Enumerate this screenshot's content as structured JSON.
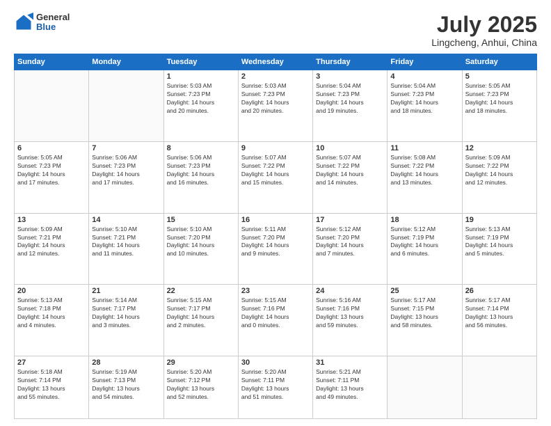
{
  "header": {
    "logo_general": "General",
    "logo_blue": "Blue",
    "month_title": "July 2025",
    "location": "Lingcheng, Anhui, China"
  },
  "weekdays": [
    "Sunday",
    "Monday",
    "Tuesday",
    "Wednesday",
    "Thursday",
    "Friday",
    "Saturday"
  ],
  "weeks": [
    [
      {
        "day": "",
        "info": ""
      },
      {
        "day": "",
        "info": ""
      },
      {
        "day": "1",
        "info": "Sunrise: 5:03 AM\nSunset: 7:23 PM\nDaylight: 14 hours\nand 20 minutes."
      },
      {
        "day": "2",
        "info": "Sunrise: 5:03 AM\nSunset: 7:23 PM\nDaylight: 14 hours\nand 20 minutes."
      },
      {
        "day": "3",
        "info": "Sunrise: 5:04 AM\nSunset: 7:23 PM\nDaylight: 14 hours\nand 19 minutes."
      },
      {
        "day": "4",
        "info": "Sunrise: 5:04 AM\nSunset: 7:23 PM\nDaylight: 14 hours\nand 18 minutes."
      },
      {
        "day": "5",
        "info": "Sunrise: 5:05 AM\nSunset: 7:23 PM\nDaylight: 14 hours\nand 18 minutes."
      }
    ],
    [
      {
        "day": "6",
        "info": "Sunrise: 5:05 AM\nSunset: 7:23 PM\nDaylight: 14 hours\nand 17 minutes."
      },
      {
        "day": "7",
        "info": "Sunrise: 5:06 AM\nSunset: 7:23 PM\nDaylight: 14 hours\nand 17 minutes."
      },
      {
        "day": "8",
        "info": "Sunrise: 5:06 AM\nSunset: 7:23 PM\nDaylight: 14 hours\nand 16 minutes."
      },
      {
        "day": "9",
        "info": "Sunrise: 5:07 AM\nSunset: 7:22 PM\nDaylight: 14 hours\nand 15 minutes."
      },
      {
        "day": "10",
        "info": "Sunrise: 5:07 AM\nSunset: 7:22 PM\nDaylight: 14 hours\nand 14 minutes."
      },
      {
        "day": "11",
        "info": "Sunrise: 5:08 AM\nSunset: 7:22 PM\nDaylight: 14 hours\nand 13 minutes."
      },
      {
        "day": "12",
        "info": "Sunrise: 5:09 AM\nSunset: 7:22 PM\nDaylight: 14 hours\nand 12 minutes."
      }
    ],
    [
      {
        "day": "13",
        "info": "Sunrise: 5:09 AM\nSunset: 7:21 PM\nDaylight: 14 hours\nand 12 minutes."
      },
      {
        "day": "14",
        "info": "Sunrise: 5:10 AM\nSunset: 7:21 PM\nDaylight: 14 hours\nand 11 minutes."
      },
      {
        "day": "15",
        "info": "Sunrise: 5:10 AM\nSunset: 7:20 PM\nDaylight: 14 hours\nand 10 minutes."
      },
      {
        "day": "16",
        "info": "Sunrise: 5:11 AM\nSunset: 7:20 PM\nDaylight: 14 hours\nand 9 minutes."
      },
      {
        "day": "17",
        "info": "Sunrise: 5:12 AM\nSunset: 7:20 PM\nDaylight: 14 hours\nand 7 minutes."
      },
      {
        "day": "18",
        "info": "Sunrise: 5:12 AM\nSunset: 7:19 PM\nDaylight: 14 hours\nand 6 minutes."
      },
      {
        "day": "19",
        "info": "Sunrise: 5:13 AM\nSunset: 7:19 PM\nDaylight: 14 hours\nand 5 minutes."
      }
    ],
    [
      {
        "day": "20",
        "info": "Sunrise: 5:13 AM\nSunset: 7:18 PM\nDaylight: 14 hours\nand 4 minutes."
      },
      {
        "day": "21",
        "info": "Sunrise: 5:14 AM\nSunset: 7:17 PM\nDaylight: 14 hours\nand 3 minutes."
      },
      {
        "day": "22",
        "info": "Sunrise: 5:15 AM\nSunset: 7:17 PM\nDaylight: 14 hours\nand 2 minutes."
      },
      {
        "day": "23",
        "info": "Sunrise: 5:15 AM\nSunset: 7:16 PM\nDaylight: 14 hours\nand 0 minutes."
      },
      {
        "day": "24",
        "info": "Sunrise: 5:16 AM\nSunset: 7:16 PM\nDaylight: 13 hours\nand 59 minutes."
      },
      {
        "day": "25",
        "info": "Sunrise: 5:17 AM\nSunset: 7:15 PM\nDaylight: 13 hours\nand 58 minutes."
      },
      {
        "day": "26",
        "info": "Sunrise: 5:17 AM\nSunset: 7:14 PM\nDaylight: 13 hours\nand 56 minutes."
      }
    ],
    [
      {
        "day": "27",
        "info": "Sunrise: 5:18 AM\nSunset: 7:14 PM\nDaylight: 13 hours\nand 55 minutes."
      },
      {
        "day": "28",
        "info": "Sunrise: 5:19 AM\nSunset: 7:13 PM\nDaylight: 13 hours\nand 54 minutes."
      },
      {
        "day": "29",
        "info": "Sunrise: 5:20 AM\nSunset: 7:12 PM\nDaylight: 13 hours\nand 52 minutes."
      },
      {
        "day": "30",
        "info": "Sunrise: 5:20 AM\nSunset: 7:11 PM\nDaylight: 13 hours\nand 51 minutes."
      },
      {
        "day": "31",
        "info": "Sunrise: 5:21 AM\nSunset: 7:11 PM\nDaylight: 13 hours\nand 49 minutes."
      },
      {
        "day": "",
        "info": ""
      },
      {
        "day": "",
        "info": ""
      }
    ]
  ]
}
